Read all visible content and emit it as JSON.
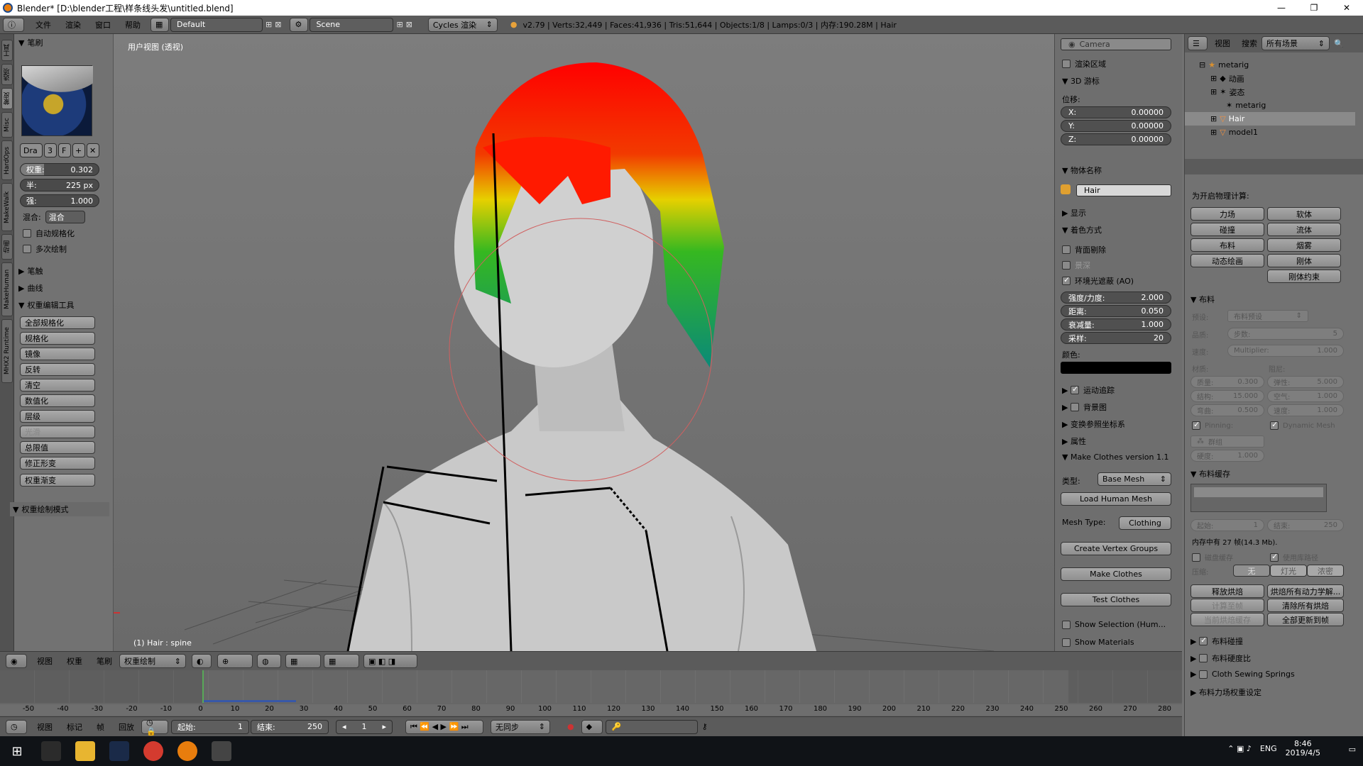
{
  "window": {
    "title": "Blender* [D:\\blender工程\\样条线头发\\untitled.blend]",
    "minimize": "—",
    "maximize": "❐",
    "close": "✕"
  },
  "infobar": {
    "menus": [
      "文件",
      "渲染",
      "窗口",
      "帮助"
    ],
    "layout": "Default",
    "scene": "Scene",
    "engine": "Cycles 渲染",
    "stats": "v2.79 | Verts:32,449 | Faces:41,936 | Tris:51,644 | Objects:1/8 | Lamps:0/3 | 内存:190.28M | Hair"
  },
  "vtabs": [
    "工具",
    "选项",
    "Misc",
    "HardOps",
    "MakeWalk",
    "动画",
    "MakeHuman",
    "MHX2 Runtime",
    "蒙皮"
  ],
  "toolshelf": {
    "brush_header": "笔刷",
    "brush_name": "Dra",
    "brush_users": "3",
    "brush_fake": "F",
    "weight_label": "权重:",
    "weight_value": "0.302",
    "radius_label": "半:",
    "radius_value": "225 px",
    "strength_label": "强:",
    "strength_value": "1.000",
    "blend_label": "混合:",
    "blend_value": "混合",
    "auto_normalize": "自动规格化",
    "multi_paint": "多次绘制",
    "stroke_header": "笔触",
    "curve_header": "曲线",
    "weight_tools_header": "权重编辑工具",
    "weight_tools": [
      "全部规格化",
      "规格化",
      "镜像",
      "反转",
      "清空",
      "数值化",
      "层级",
      "光滑",
      "总限值",
      "修正形变",
      "权重渐变"
    ],
    "paint_mode_header": "权重绘制模式"
  },
  "viewport": {
    "view_label": "用户视图 (透视)",
    "object_info": "(1) Hair : spine"
  },
  "npanel": {
    "camera_field": "Camera",
    "render_border": "渲染区域",
    "cursor_header": "3D 游标",
    "location_label": "位移:",
    "x_label": "X:",
    "x_value": "0.00000",
    "y_label": "Y:",
    "y_value": "0.00000",
    "z_label": "Z:",
    "z_value": "0.00000",
    "item_header": "物体名称",
    "object_name": "Hair",
    "display_header": "显示",
    "shading_header": "着色方式",
    "backface": "背面剔除",
    "dof": "景深",
    "ao": "环境光遮蔽 (AO)",
    "strength_label": "强度/力度:",
    "strength_value": "2.000",
    "distance_label": "距离:",
    "distance_value": "0.050",
    "attenuation_label": "衰减量:",
    "attenuation_value": "1.000",
    "samples_label": "采样:",
    "samples_value": "20",
    "color_label": "颜色:",
    "motion_tracking": "运动追踪",
    "background_images": "背景图",
    "transform_orient": "变换参照坐标系",
    "properties": "属性",
    "makeclothes_header": "Make Clothes version 1.1",
    "type_label": "类型:",
    "type_value": "Base Mesh",
    "load_human": "Load Human Mesh",
    "mesh_type_label": "Mesh Type:",
    "mesh_type_value": "Clothing",
    "create_vgroups": "Create Vertex Groups",
    "make_clothes": "Make Clothes",
    "test_clothes": "Test Clothes",
    "show_selection": "Show Selection (Hum...",
    "show_materials": "Show Materials"
  },
  "outliner": {
    "menu_view": "视图",
    "menu_search": "搜索",
    "filter": "所有场景",
    "rows": [
      "metarig",
      "动画",
      "姿态",
      "metarig",
      "Hair",
      "model1"
    ]
  },
  "physics": {
    "enable_label": "为开启物理计算:",
    "buttons_left": [
      "力场",
      "碰撞",
      "布料",
      "动态绘画"
    ],
    "buttons_right": [
      "软体",
      "流体",
      "烟雾",
      "刚体",
      "刚体约束"
    ],
    "cloth_header": "布料",
    "preset_label": "预设:",
    "preset_value": "布料预设",
    "quality_label": "品质:",
    "steps_label": "步数:",
    "steps_value": "5",
    "speed_label": "速度:",
    "multiplier_label": "Multiplier:",
    "multiplier_value": "1.000",
    "material_label": "材质:",
    "damping_label": "阻尼:",
    "mass_label": "质量:",
    "mass_value": "0.300",
    "spring_label": "弹性:",
    "spring_value": "5.000",
    "structural_label": "结构:",
    "structural_value": "15.000",
    "air_label": "空气:",
    "air_value": "1.000",
    "bending_label": "弯曲:",
    "bending_value": "0.500",
    "velocity_label": "速度:",
    "velocity_value": "1.000",
    "pinning": "Pinning:",
    "dynamic_mesh": "Dynamic Mesh",
    "group_label": "群组",
    "stiffness_label": "硬度:",
    "stiffness_value": "1.000",
    "cache_header": "布料缓存",
    "start_label": "起始:",
    "start_value": "1",
    "end_label": "结束:",
    "end_value": "250",
    "mem_info": "内存中有 27 帧(14.3 Mb).",
    "disk_cache": "磁盘缓存",
    "lib_path": "使用库路径",
    "compress_label": "压缩:",
    "compress_options": [
      "无",
      "灯光",
      "浓密"
    ],
    "free_bake": "释放烘焙",
    "bake_all_dynamics": "烘焙所有动力学解...",
    "calc_to_frame": "计算至帧",
    "free_all_bakes": "清除所有烘焙",
    "current_cache": "当前烘焙缓存",
    "update_all_to_frame": "全部更新到帧",
    "cloth_collision": "布料碰撞",
    "cloth_stiffness": "布料硬度比",
    "sewing_springs": "Cloth Sewing Springs",
    "field_weights": "布料力场权重设定"
  },
  "viewport_header": {
    "menus": [
      "视图",
      "权重",
      "笔刷"
    ],
    "mode": "权重绘制"
  },
  "timeline": {
    "ticks": [
      "-50",
      "-40",
      "-30",
      "-20",
      "-10",
      "0",
      "10",
      "20",
      "30",
      "40",
      "50",
      "60",
      "70",
      "80",
      "90",
      "100",
      "110",
      "120",
      "130",
      "140",
      "150",
      "160",
      "170",
      "180",
      "190",
      "200",
      "210",
      "220",
      "230",
      "240",
      "250",
      "260",
      "270",
      "280"
    ],
    "menus": [
      "视图",
      "标记",
      "帧",
      "回放"
    ],
    "start_label": "起始:",
    "start_value": "1",
    "end_label": "结束:",
    "end_value": "250",
    "current_frame": "1",
    "sync": "无同步"
  },
  "taskbar": {
    "lang": "ENG",
    "time": "8:46",
    "date": "2019/4/5"
  }
}
